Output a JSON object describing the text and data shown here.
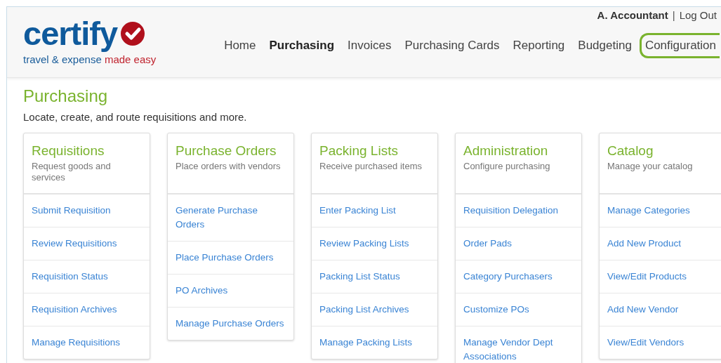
{
  "logo": {
    "wordmark": "certify",
    "tagline": "travel & expense",
    "tagline_accent": "made easy"
  },
  "user": {
    "name": "A. Accountant",
    "separator": "|",
    "logout": "Log Out"
  },
  "nav": [
    {
      "label": "Home",
      "selected": false,
      "outlined": false
    },
    {
      "label": "Purchasing",
      "selected": true,
      "outlined": false
    },
    {
      "label": "Invoices",
      "selected": false,
      "outlined": false
    },
    {
      "label": "Purchasing Cards",
      "selected": false,
      "outlined": false
    },
    {
      "label": "Reporting",
      "selected": false,
      "outlined": false
    },
    {
      "label": "Budgeting",
      "selected": false,
      "outlined": false
    },
    {
      "label": "Configuration",
      "selected": false,
      "outlined": true
    }
  ],
  "page": {
    "title": "Purchasing",
    "subtitle": "Locate, create, and route requisitions and more."
  },
  "cards": [
    {
      "title": "Requisitions",
      "description": "Request goods and services",
      "links": [
        "Submit Requisition",
        "Review Requisitions",
        "Requisition Status",
        "Requisition Archives",
        "Manage Requisitions"
      ]
    },
    {
      "title": "Purchase Orders",
      "description": "Place orders with vendors",
      "links": [
        "Generate Purchase Orders",
        "Place Purchase Orders",
        "PO Archives",
        "Manage Purchase Orders"
      ]
    },
    {
      "title": "Packing Lists",
      "description": "Receive purchased items",
      "links": [
        "Enter Packing List",
        "Review Packing Lists",
        "Packing List Status",
        "Packing List Archives",
        "Manage Packing Lists"
      ]
    },
    {
      "title": "Administration",
      "description": "Configure purchasing",
      "links": [
        "Requisition Delegation",
        "Order Pads",
        "Category Purchasers",
        "Customize POs",
        "Manage Vendor Dept Associations"
      ]
    },
    {
      "title": "Catalog",
      "description": "Manage your catalog",
      "links": [
        "Manage Categories",
        "Add New Product",
        "View/Edit Products",
        "Add New Vendor",
        "View/Edit Vendors"
      ]
    }
  ]
}
